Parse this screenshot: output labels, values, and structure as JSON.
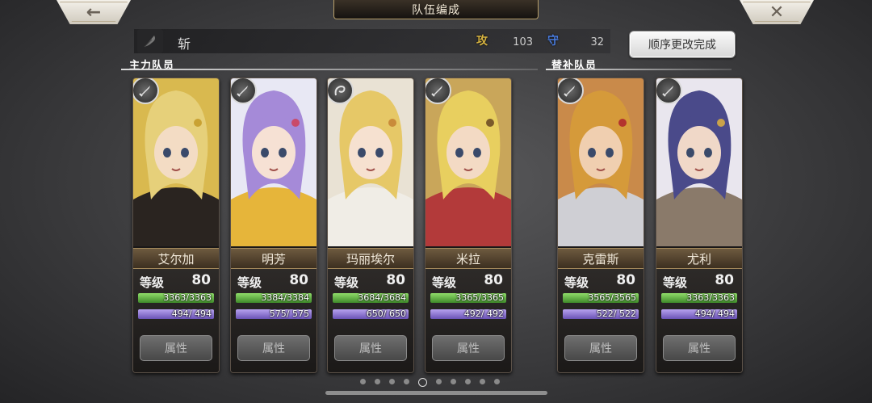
{
  "header": {
    "title": "队伍编成",
    "back_icon": "←",
    "close_icon": "✕"
  },
  "team": {
    "name": "斩",
    "atk_icon": "攻",
    "atk_value": "103",
    "def_icon": "守",
    "def_value": "32",
    "order_button": "顺序更改完成"
  },
  "sections": {
    "main": "主力队员",
    "sub": "替补队员"
  },
  "labels": {
    "level": "等级",
    "attribute": "属性"
  },
  "cards": [
    {
      "name": "艾尔加",
      "level": "80",
      "hp": "3363/3363",
      "sp": "494/ 494",
      "weapon": "sword"
    },
    {
      "name": "明芳",
      "level": "80",
      "hp": "3384/3384",
      "sp": "575/ 575",
      "weapon": "sword"
    },
    {
      "name": "玛丽埃尔",
      "level": "80",
      "hp": "3684/3684",
      "sp": "650/ 650",
      "weapon": "whip"
    },
    {
      "name": "米拉",
      "level": "80",
      "hp": "3365/3365",
      "sp": "492/ 492",
      "weapon": "sword"
    },
    {
      "name": "克雷斯",
      "level": "80",
      "hp": "3565/3565",
      "sp": "522/ 522",
      "weapon": "sword"
    },
    {
      "name": "尤利",
      "level": "80",
      "hp": "3363/3363",
      "sp": "494/ 494",
      "weapon": "sword"
    }
  ],
  "pager": {
    "total": 10,
    "active": 4
  },
  "colors": {
    "hp": "#5fb847",
    "sp": "#8d74d6",
    "nameplate": "#5a4a34"
  }
}
